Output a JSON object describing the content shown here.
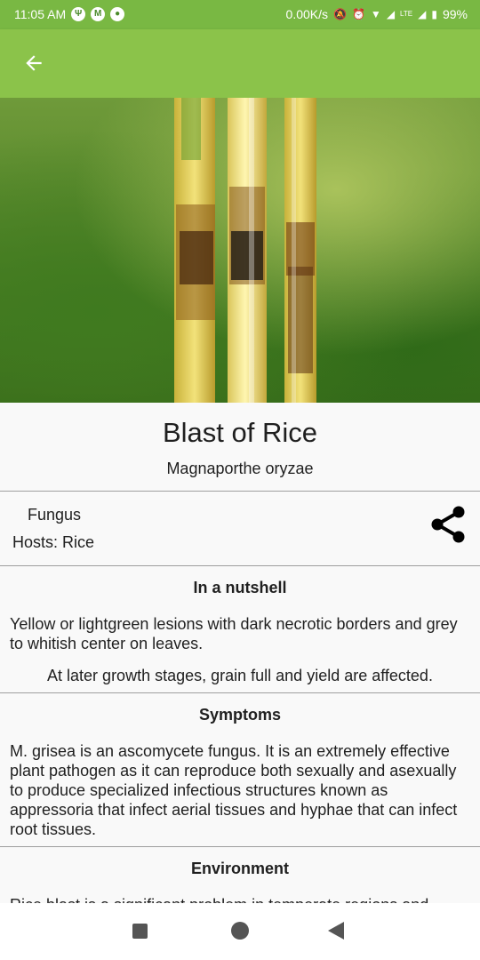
{
  "status_bar": {
    "time": "11:05 AM",
    "net_speed": "0.00K/s",
    "battery": "99%",
    "icons": [
      "usb-icon",
      "gmail-icon",
      "android-icon",
      "mute-icon",
      "alarm-icon",
      "wifi-icon",
      "signal-icon",
      "volte-icon",
      "battery-icon"
    ]
  },
  "app_bar": {
    "back_icon": "arrow-left-icon",
    "color": "#8bc34a"
  },
  "disease": {
    "name": "Blast of Rice",
    "scientific_name": "Magnaporthe oryzae",
    "type": "Fungus",
    "hosts": "Hosts: Rice"
  },
  "sections": {
    "nutshell": {
      "title": "In a nutshell",
      "paragraphs": [
        "Yellow or lightgreen lesions with dark necrotic borders and grey to whitish center on leaves.",
        "At later growth stages, grain full and yield are affected."
      ]
    },
    "symptoms": {
      "title": "Symptoms",
      "text": "M. grisea is an ascomycete fungus. It is an extremely effective plant pathogen as it can reproduce both sexually and asexually to produce specialized infectious structures known as appressoria that infect aerial tissues and hyphae that can infect root tissues."
    },
    "environment": {
      "title": "Environment",
      "text": "Rice blast is a significant problem in temperate regions and"
    }
  },
  "nav": {
    "icons": [
      "recents-icon",
      "home-icon",
      "back-icon"
    ]
  }
}
